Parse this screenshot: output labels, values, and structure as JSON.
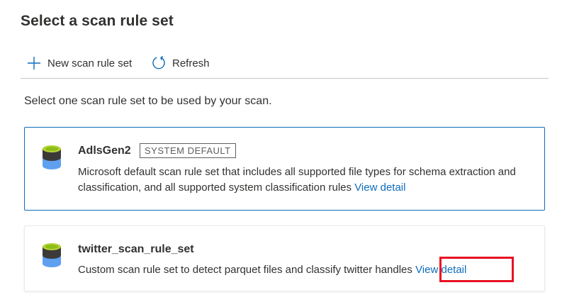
{
  "panel": {
    "title": "Select a scan rule set"
  },
  "toolbar": {
    "new_label": "New scan rule set",
    "new_icon": "plus-icon",
    "refresh_label": "Refresh",
    "refresh_icon": "refresh-icon"
  },
  "instruction": "Select one scan rule set to be used by your scan.",
  "rule_sets": [
    {
      "name": "AdlsGen2",
      "badge": "SYSTEM DEFAULT",
      "description": "Microsoft default scan rule set that includes all supported file types for schema extraction and classification, and all supported system classification rules",
      "link_label": "View detail",
      "icon": "database-icon",
      "selected": true
    },
    {
      "name": "twitter_scan_rule_set",
      "description": "Custom scan rule set to detect parquet files and classify twitter handles",
      "link_label": "View detail",
      "icon": "database-icon",
      "selected": false
    }
  ],
  "colors": {
    "accent": "#0f6cbd",
    "highlight": "#e81123",
    "text": "#323130"
  }
}
